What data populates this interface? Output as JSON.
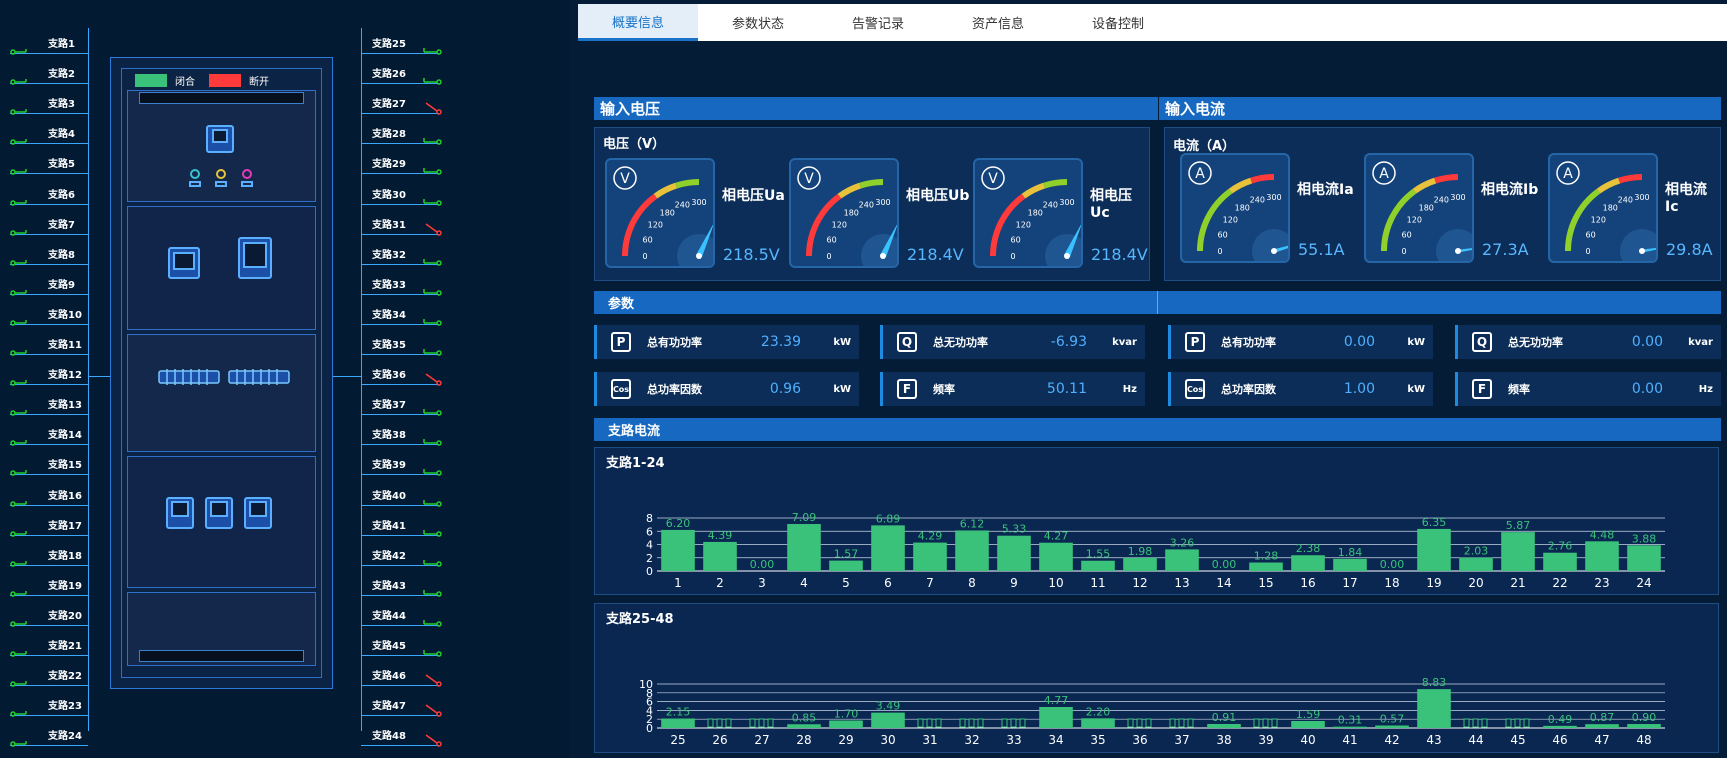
{
  "branches_left": [
    "支路1",
    "支路2",
    "支路3",
    "支路4",
    "支路5",
    "支路6",
    "支路7",
    "支路8",
    "支路9",
    "支路10",
    "支路11",
    "支路12",
    "支路13",
    "支路14",
    "支路15",
    "支路16",
    "支路17",
    "支路18",
    "支路19",
    "支路20",
    "支路21",
    "支路22",
    "支路23",
    "支路24"
  ],
  "branches_right": [
    "支路25",
    "支路26",
    "支路27",
    "支路28",
    "支路29",
    "支路30",
    "支路31",
    "支路32",
    "支路33",
    "支路34",
    "支路35",
    "支路36",
    "支路37",
    "支路38",
    "支路39",
    "支路40",
    "支路41",
    "支路42",
    "支路43",
    "支路44",
    "支路45",
    "支路46",
    "支路47",
    "支路48"
  ],
  "right_switch_open": [
    false,
    false,
    true,
    false,
    false,
    false,
    true,
    false,
    false,
    false,
    false,
    true,
    false,
    false,
    false,
    false,
    false,
    false,
    false,
    false,
    false,
    true,
    true,
    true
  ],
  "legend": {
    "closed": "闭合",
    "open": "断开",
    "closed_color": "#3ac27a",
    "open_color": "#ff3a3a"
  },
  "tabs": [
    "概要信息",
    "参数状态",
    "告警记录",
    "资产信息",
    "设备控制"
  ],
  "sections": {
    "voltage": "输入电压",
    "current": "输入电流",
    "params": "参数",
    "branch": "支路电流"
  },
  "voltage": {
    "title": "电压（V）",
    "gauges": [
      {
        "letter": "V",
        "name": "相电压Ua",
        "value": "218.5V",
        "reading": 218.5
      },
      {
        "letter": "V",
        "name": "相电压Ub",
        "value": "218.4V",
        "reading": 218.4
      },
      {
        "letter": "V",
        "name": "相电压Uc",
        "value": "218.4V",
        "reading": 218.4
      }
    ]
  },
  "current": {
    "title": "电流（A）",
    "gauges": [
      {
        "letter": "A",
        "name": "相电流Ia",
        "value": "55.1A",
        "reading": 55.1
      },
      {
        "letter": "A",
        "name": "相电流Ib",
        "value": "27.3A",
        "reading": 27.3
      },
      {
        "letter": "A",
        "name": "相电流Ic",
        "value": "29.8A",
        "reading": 29.8
      }
    ]
  },
  "gauge_ticks": [
    "0",
    "60",
    "120",
    "180",
    "240",
    "300"
  ],
  "params": [
    {
      "icon": "P",
      "name": "总有功功率",
      "value": "23.39",
      "unit": "kW"
    },
    {
      "icon": "Q",
      "name": "总无功功率",
      "value": "-6.93",
      "unit": "kvar"
    },
    {
      "icon": "P",
      "name": "总有功功率",
      "value": "0.00",
      "unit": "kW"
    },
    {
      "icon": "Q",
      "name": "总无功功率",
      "value": "0.00",
      "unit": "kvar"
    },
    {
      "icon": "Cos",
      "name": "总功率因数",
      "value": "0.96",
      "unit": "kW"
    },
    {
      "icon": "F",
      "name": "频率",
      "value": "50.11",
      "unit": "Hz"
    },
    {
      "icon": "Cos",
      "name": "总功率因数",
      "value": "1.00",
      "unit": "kW"
    },
    {
      "icon": "F",
      "name": "频率",
      "value": "0.00",
      "unit": "Hz"
    }
  ],
  "chart_data": [
    {
      "type": "bar",
      "title": "支路1-24",
      "categories": [
        "1",
        "2",
        "3",
        "4",
        "5",
        "6",
        "7",
        "8",
        "9",
        "10",
        "11",
        "12",
        "13",
        "14",
        "15",
        "16",
        "17",
        "18",
        "19",
        "20",
        "21",
        "22",
        "23",
        "24"
      ],
      "values": [
        6.2,
        4.39,
        0.0,
        7.09,
        1.57,
        6.89,
        4.29,
        6.12,
        5.33,
        4.27,
        1.55,
        1.98,
        3.26,
        0.0,
        1.28,
        2.38,
        1.84,
        0.0,
        6.35,
        2.03,
        5.87,
        2.76,
        4.48,
        3.88
      ],
      "labels": [
        "6.20",
        "4.39",
        "0.00",
        "7.09",
        "1.57",
        "6.89",
        "4.29",
        "6.12",
        "5.33",
        "4.27",
        "1.55",
        "1.98",
        "3.26",
        "0.00",
        "1.28",
        "2.38",
        "1.84",
        "0.00",
        "6.35",
        "2.03",
        "5.87",
        "2.76",
        "4.48",
        "3.88"
      ],
      "yticks": [
        "0",
        "2",
        "4",
        "6",
        "8"
      ],
      "ylim": [
        0,
        8
      ]
    },
    {
      "type": "bar",
      "title": "支路25-48",
      "categories": [
        "25",
        "26",
        "27",
        "28",
        "29",
        "30",
        "31",
        "32",
        "33",
        "34",
        "35",
        "36",
        "37",
        "38",
        "39",
        "40",
        "41",
        "42",
        "43",
        "44",
        "45",
        "46",
        "47",
        "48"
      ],
      "values": [
        2.15,
        null,
        null,
        0.85,
        1.7,
        3.49,
        null,
        null,
        null,
        4.77,
        2.2,
        null,
        null,
        0.91,
        null,
        1.59,
        0.31,
        0.57,
        8.83,
        null,
        null,
        0.49,
        0.87,
        0.9
      ],
      "labels": [
        "2.15",
        "",
        "",
        "0.85",
        "1.70",
        "3.49",
        "",
        "",
        "",
        "4.77",
        "2.20",
        "",
        "",
        "0.91",
        "",
        "1.59",
        "0.31",
        "0.57",
        "8.83",
        "",
        "",
        "0.49",
        "0.87",
        "0.90"
      ],
      "yticks": [
        "0",
        "2",
        "4",
        "6",
        "8",
        "10"
      ],
      "ylim": [
        0,
        10
      ]
    }
  ],
  "colors": {
    "bar": "#3ac27a",
    "accent": "#1668c0",
    "value": "#4fb0ff"
  }
}
